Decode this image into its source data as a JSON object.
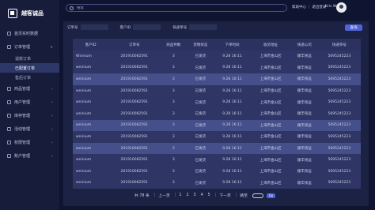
{
  "sidebar": {
    "logo": "越客诚品",
    "items": [
      {
        "label": "首页实时数据",
        "chev": ""
      },
      {
        "label": "订单管理",
        "chev": "∨"
      },
      {
        "label": "商品管理",
        "chev": "›"
      },
      {
        "label": "用户管理",
        "chev": "›"
      },
      {
        "label": "库存管理",
        "chev": "›"
      },
      {
        "label": "活动管理",
        "chev": "›"
      },
      {
        "label": "权限管理",
        "chev": "›"
      },
      {
        "label": "账户管理",
        "chev": "›"
      }
    ],
    "subitems": [
      "退款订单",
      "已配置订单",
      "售后订单"
    ]
  },
  "topbar": {
    "search_placeholder": "搜索",
    "links": "帮助中心 ｜ 退出登录",
    "user": "Kris Wu"
  },
  "filters": {
    "order_label": "订单号",
    "customer_label": "客户ID",
    "express_label": "快递单号",
    "query_button": "查询"
  },
  "table": {
    "headers": [
      "客户ID",
      "订单号",
      "商品件数",
      "货物状态",
      "下单时间",
      "收货地址",
      "快递公司",
      "快递单号"
    ],
    "rows": [
      [
        "Wninium",
        "201910082591",
        "3",
        "已发货",
        "9.28  16:11",
        "上海市金山区",
        "顺丰快运",
        "5695245223"
      ],
      [
        "wninium",
        "201910082591",
        "3",
        "已发货",
        "9.28  16:11",
        "上海市金山区",
        "顺丰快运",
        "5695245223"
      ],
      [
        "wninium",
        "201910082591",
        "3",
        "已发货",
        "9.28  16:11",
        "上海市金山区",
        "顺丰快运",
        "5695245223"
      ],
      [
        "wninium",
        "201910082591",
        "3",
        "已发货",
        "9.28  16:11",
        "上海市金山区",
        "顺丰快运",
        "5695245223"
      ],
      [
        "wninium",
        "201910082591",
        "3",
        "已发货",
        "9.28  16:11",
        "上海市金山区",
        "顺丰快运",
        "5695245223"
      ],
      [
        "wninium",
        "201910082591",
        "3",
        "已发货",
        "9.28  16:11",
        "上海市金山区",
        "顺丰快运",
        "5695245223"
      ],
      [
        "wninium",
        "201910082591",
        "3",
        "已发货",
        "9.28  16:11",
        "上海市金山区",
        "顺丰快运",
        "5695245223"
      ],
      [
        "wninium",
        "201910082591",
        "3",
        "已发货",
        "9.28  16:11",
        "上海市金山区",
        "顺丰快运",
        "5695245223"
      ],
      [
        "wninium",
        "201910082591",
        "3",
        "已发货",
        "9.28  16:11",
        "上海市金山区",
        "顺丰快运",
        "5695245223"
      ],
      [
        "wninium",
        "201910082591",
        "3",
        "已发货",
        "9.28  16:11",
        "上海市金山区",
        "顺丰快运",
        "5695245223"
      ],
      [
        "wninium",
        "201910082591",
        "3",
        "已发货",
        "9.28  16:11",
        "上海市金山区",
        "顺丰快运",
        "5695245223"
      ],
      [
        "wninium",
        "201910082591",
        "3",
        "已发货",
        "9.28  16:11",
        "上海市金山区",
        "顺丰快运",
        "5695245223"
      ]
    ],
    "highlighted_rows": [
      2,
      6,
      8
    ]
  },
  "pager": {
    "total": "共 78 条",
    "prev": "上一页",
    "pages": [
      "1",
      "2",
      "3",
      "4",
      "5"
    ],
    "next": "下一页",
    "jump_label": "跳至",
    "go": "Go"
  }
}
